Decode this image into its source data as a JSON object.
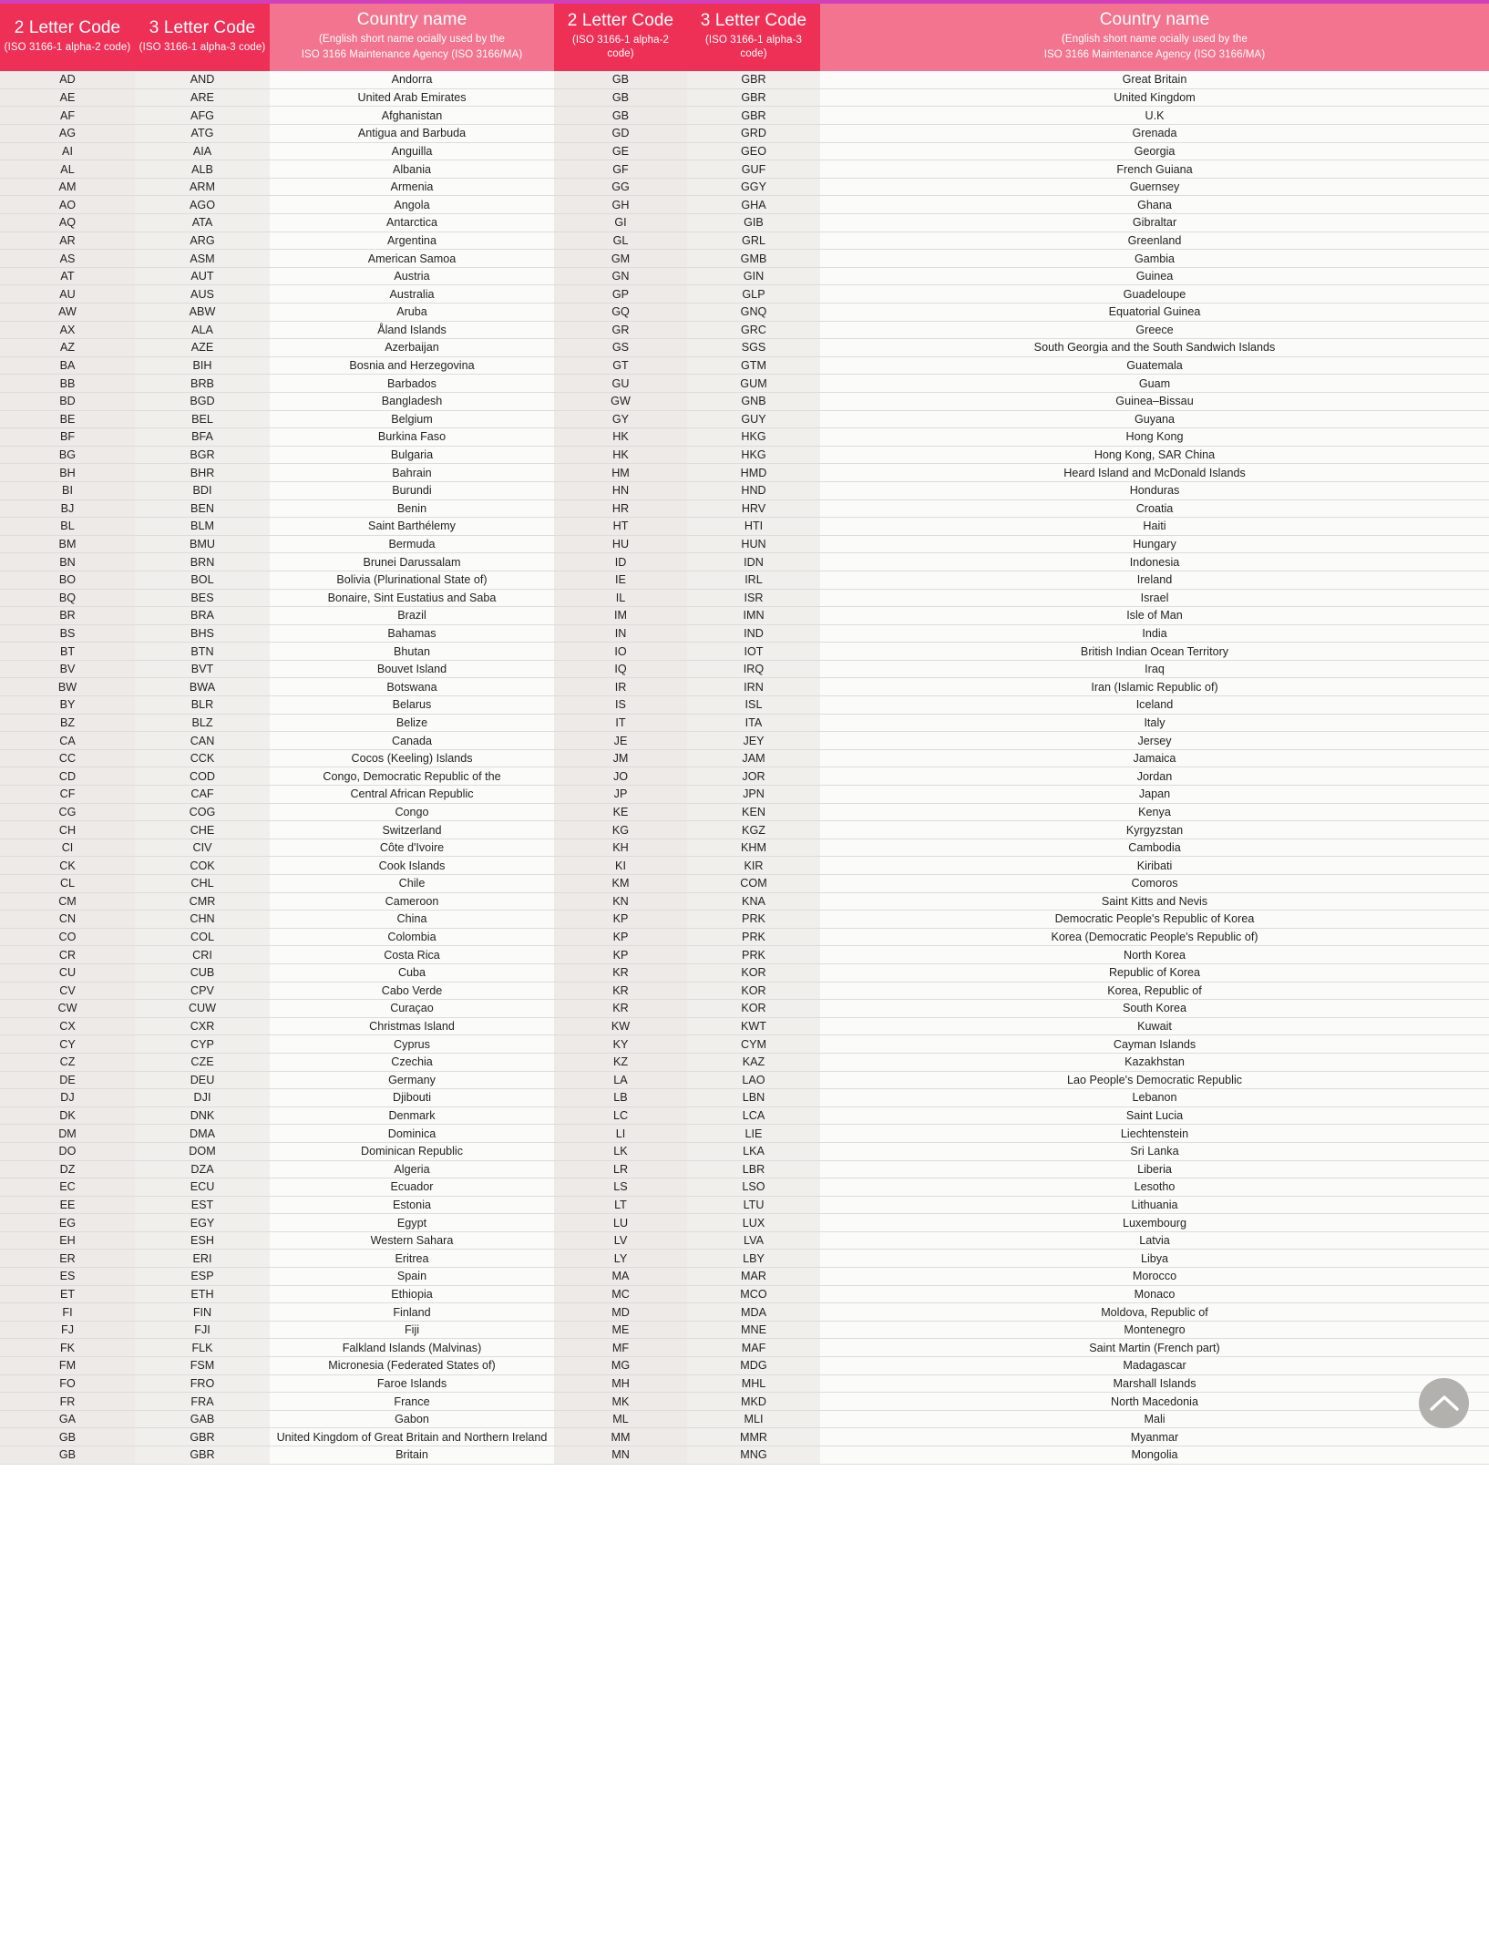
{
  "colors": {
    "accent_code_header": "#ef3056",
    "accent_name_header": "#f2748f",
    "top_rule": "#cf3fbe",
    "row_code2_bg": "#edeae7",
    "row_code3_bg": "#f1efec",
    "row_name_bg": "#fbfbfa",
    "scroll_button_bg": "#b3b1ae"
  },
  "headers": {
    "code2_title": "2 Letter Code",
    "code2_sub": "(ISO 3166‑1 alpha‑2 code)",
    "code3_title": "3 Letter Code",
    "code3_sub": "(ISO 3166‑1 alpha‑3 code)",
    "name_title": "Country name",
    "name_sub_line1": "(English short name ocially used by the",
    "name_sub_line2": "ISO 3166 Maintenance Agency (ISO 3166/MA)"
  },
  "scroll_top": {
    "icon": "chevron-up-icon",
    "label": "Scroll to top"
  },
  "chart_data": {
    "type": "table",
    "title": "ISO 3166-1 country codes",
    "columns": [
      "2 Letter Code",
      "3 Letter Code",
      "Country name"
    ],
    "left_rows": [
      [
        "AD",
        "AND",
        "Andorra"
      ],
      [
        "AE",
        "ARE",
        "United Arab Emirates"
      ],
      [
        "AF",
        "AFG",
        "Afghanistan"
      ],
      [
        "AG",
        "ATG",
        "Antigua and Barbuda"
      ],
      [
        "AI",
        "AIA",
        "Anguilla"
      ],
      [
        "AL",
        "ALB",
        "Albania"
      ],
      [
        "AM",
        "ARM",
        "Armenia"
      ],
      [
        "AO",
        "AGO",
        "Angola"
      ],
      [
        "AQ",
        "ATA",
        "Antarctica"
      ],
      [
        "AR",
        "ARG",
        "Argentina"
      ],
      [
        "AS",
        "ASM",
        "American Samoa"
      ],
      [
        "AT",
        "AUT",
        "Austria"
      ],
      [
        "AU",
        "AUS",
        "Australia"
      ],
      [
        "AW",
        "ABW",
        "Aruba"
      ],
      [
        "AX",
        "ALA",
        "Åland Islands"
      ],
      [
        "AZ",
        "AZE",
        "Azerbaijan"
      ],
      [
        "BA",
        "BIH",
        "Bosnia and Herzegovina"
      ],
      [
        "BB",
        "BRB",
        "Barbados"
      ],
      [
        "BD",
        "BGD",
        "Bangladesh"
      ],
      [
        "BE",
        "BEL",
        "Belgium"
      ],
      [
        "BF",
        "BFA",
        "Burkina Faso"
      ],
      [
        "BG",
        "BGR",
        "Bulgaria"
      ],
      [
        "BH",
        "BHR",
        "Bahrain"
      ],
      [
        "BI",
        "BDI",
        "Burundi"
      ],
      [
        "BJ",
        "BEN",
        "Benin"
      ],
      [
        "BL",
        "BLM",
        "Saint Barthélemy"
      ],
      [
        "BM",
        "BMU",
        "Bermuda"
      ],
      [
        "BN",
        "BRN",
        "Brunei Darussalam"
      ],
      [
        "BO",
        "BOL",
        "Bolivia (Plurinational State of)"
      ],
      [
        "BQ",
        "BES",
        "Bonaire, Sint Eustatius and Saba"
      ],
      [
        "BR",
        "BRA",
        "Brazil"
      ],
      [
        "BS",
        "BHS",
        "Bahamas"
      ],
      [
        "BT",
        "BTN",
        "Bhutan"
      ],
      [
        "BV",
        "BVT",
        "Bouvet Island"
      ],
      [
        "BW",
        "BWA",
        "Botswana"
      ],
      [
        "BY",
        "BLR",
        "Belarus"
      ],
      [
        "BZ",
        "BLZ",
        "Belize"
      ],
      [
        "CA",
        "CAN",
        "Canada"
      ],
      [
        "CC",
        "CCK",
        "Cocos (Keeling) Islands"
      ],
      [
        "CD",
        "COD",
        "Congo, Democratic Republic of the"
      ],
      [
        "CF",
        "CAF",
        "Central African Republic"
      ],
      [
        "CG",
        "COG",
        "Congo"
      ],
      [
        "CH",
        "CHE",
        "Switzerland"
      ],
      [
        "CI",
        "CIV",
        "Côte d'Ivoire"
      ],
      [
        "CK",
        "COK",
        "Cook Islands"
      ],
      [
        "CL",
        "CHL",
        "Chile"
      ],
      [
        "CM",
        "CMR",
        "Cameroon"
      ],
      [
        "CN",
        "CHN",
        "China"
      ],
      [
        "CO",
        "COL",
        "Colombia"
      ],
      [
        "CR",
        "CRI",
        "Costa Rica"
      ],
      [
        "CU",
        "CUB",
        "Cuba"
      ],
      [
        "CV",
        "CPV",
        "Cabo Verde"
      ],
      [
        "CW",
        "CUW",
        "Curaçao"
      ],
      [
        "CX",
        "CXR",
        "Christmas Island"
      ],
      [
        "CY",
        "CYP",
        "Cyprus"
      ],
      [
        "CZ",
        "CZE",
        "Czechia"
      ],
      [
        "DE",
        "DEU",
        "Germany"
      ],
      [
        "DJ",
        "DJI",
        "Djibouti"
      ],
      [
        "DK",
        "DNK",
        "Denmark"
      ],
      [
        "DM",
        "DMA",
        "Dominica"
      ],
      [
        "DO",
        "DOM",
        "Dominican Republic"
      ],
      [
        "DZ",
        "DZA",
        "Algeria"
      ],
      [
        "EC",
        "ECU",
        "Ecuador"
      ],
      [
        "EE",
        "EST",
        "Estonia"
      ],
      [
        "EG",
        "EGY",
        "Egypt"
      ],
      [
        "EH",
        "ESH",
        "Western Sahara"
      ],
      [
        "ER",
        "ERI",
        "Eritrea"
      ],
      [
        "ES",
        "ESP",
        "Spain"
      ],
      [
        "ET",
        "ETH",
        "Ethiopia"
      ],
      [
        "FI",
        "FIN",
        "Finland"
      ],
      [
        "FJ",
        "FJI",
        "Fiji"
      ],
      [
        "FK",
        "FLK",
        "Falkland Islands (Malvinas)"
      ],
      [
        "FM",
        "FSM",
        "Micronesia (Federated States of)"
      ],
      [
        "FO",
        "FRO",
        "Faroe Islands"
      ],
      [
        "FR",
        "FRA",
        "France"
      ],
      [
        "GA",
        "GAB",
        "Gabon"
      ],
      [
        "GB",
        "GBR",
        "United Kingdom of Great Britain and Northern Ireland"
      ],
      [
        "GB",
        "GBR",
        "Britain"
      ]
    ],
    "right_rows": [
      [
        "GB",
        "GBR",
        "Great Britain"
      ],
      [
        "GB",
        "GBR",
        "United Kingdom"
      ],
      [
        "GB",
        "GBR",
        "U.K"
      ],
      [
        "GD",
        "GRD",
        "Grenada"
      ],
      [
        "GE",
        "GEO",
        "Georgia"
      ],
      [
        "GF",
        "GUF",
        "French Guiana"
      ],
      [
        "GG",
        "GGY",
        "Guernsey"
      ],
      [
        "GH",
        "GHA",
        "Ghana"
      ],
      [
        "GI",
        "GIB",
        "Gibraltar"
      ],
      [
        "GL",
        "GRL",
        "Greenland"
      ],
      [
        "GM",
        "GMB",
        "Gambia"
      ],
      [
        "GN",
        "GIN",
        "Guinea"
      ],
      [
        "GP",
        "GLP",
        "Guadeloupe"
      ],
      [
        "GQ",
        "GNQ",
        "Equatorial Guinea"
      ],
      [
        "GR",
        "GRC",
        "Greece"
      ],
      [
        "GS",
        "SGS",
        "South Georgia and the South Sandwich Islands"
      ],
      [
        "GT",
        "GTM",
        "Guatemala"
      ],
      [
        "GU",
        "GUM",
        "Guam"
      ],
      [
        "GW",
        "GNB",
        "Guinea–Bissau"
      ],
      [
        "GY",
        "GUY",
        "Guyana"
      ],
      [
        "HK",
        "HKG",
        "Hong Kong"
      ],
      [
        "HK",
        "HKG",
        "Hong Kong, SAR China"
      ],
      [
        "HM",
        "HMD",
        "Heard Island and McDonald Islands"
      ],
      [
        "HN",
        "HND",
        "Honduras"
      ],
      [
        "HR",
        "HRV",
        "Croatia"
      ],
      [
        "HT",
        "HTI",
        "Haiti"
      ],
      [
        "HU",
        "HUN",
        "Hungary"
      ],
      [
        "ID",
        "IDN",
        "Indonesia"
      ],
      [
        "IE",
        "IRL",
        "Ireland"
      ],
      [
        "IL",
        "ISR",
        "Israel"
      ],
      [
        "IM",
        "IMN",
        "Isle of Man"
      ],
      [
        "IN",
        "IND",
        "India"
      ],
      [
        "IO",
        "IOT",
        "British Indian Ocean Territory"
      ],
      [
        "IQ",
        "IRQ",
        "Iraq"
      ],
      [
        "IR",
        "IRN",
        "Iran (Islamic Republic of)"
      ],
      [
        "IS",
        "ISL",
        "Iceland"
      ],
      [
        "IT",
        "ITA",
        "Italy"
      ],
      [
        "JE",
        "JEY",
        "Jersey"
      ],
      [
        "JM",
        "JAM",
        "Jamaica"
      ],
      [
        "JO",
        "JOR",
        "Jordan"
      ],
      [
        "JP",
        "JPN",
        "Japan"
      ],
      [
        "KE",
        "KEN",
        "Kenya"
      ],
      [
        "KG",
        "KGZ",
        "Kyrgyzstan"
      ],
      [
        "KH",
        "KHM",
        "Cambodia"
      ],
      [
        "KI",
        "KIR",
        "Kiribati"
      ],
      [
        "KM",
        "COM",
        "Comoros"
      ],
      [
        "KN",
        "KNA",
        "Saint Kitts and Nevis"
      ],
      [
        "KP",
        "PRK",
        "Democratic People's Republic of Korea"
      ],
      [
        "KP",
        "PRK",
        "Korea (Democratic People's Republic of)"
      ],
      [
        "KP",
        "PRK",
        "North Korea"
      ],
      [
        "KR",
        "KOR",
        "Republic of Korea"
      ],
      [
        "KR",
        "KOR",
        "Korea, Republic of"
      ],
      [
        "KR",
        "KOR",
        "South Korea"
      ],
      [
        "KW",
        "KWT",
        "Kuwait"
      ],
      [
        "KY",
        "CYM",
        "Cayman Islands"
      ],
      [
        "KZ",
        "KAZ",
        "Kazakhstan"
      ],
      [
        "LA",
        "LAO",
        "Lao People's Democratic Republic"
      ],
      [
        "LB",
        "LBN",
        "Lebanon"
      ],
      [
        "LC",
        "LCA",
        "Saint Lucia"
      ],
      [
        "LI",
        "LIE",
        "Liechtenstein"
      ],
      [
        "LK",
        "LKA",
        "Sri Lanka"
      ],
      [
        "LR",
        "LBR",
        "Liberia"
      ],
      [
        "LS",
        "LSO",
        "Lesotho"
      ],
      [
        "LT",
        "LTU",
        "Lithuania"
      ],
      [
        "LU",
        "LUX",
        "Luxembourg"
      ],
      [
        "LV",
        "LVA",
        "Latvia"
      ],
      [
        "LY",
        "LBY",
        "Libya"
      ],
      [
        "MA",
        "MAR",
        "Morocco"
      ],
      [
        "MC",
        "MCO",
        "Monaco"
      ],
      [
        "MD",
        "MDA",
        "Moldova, Republic of"
      ],
      [
        "ME",
        "MNE",
        "Montenegro"
      ],
      [
        "MF",
        "MAF",
        "Saint Martin (French part)"
      ],
      [
        "MG",
        "MDG",
        "Madagascar"
      ],
      [
        "MH",
        "MHL",
        "Marshall Islands"
      ],
      [
        "MK",
        "MKD",
        "North Macedonia"
      ],
      [
        "ML",
        "MLI",
        "Mali"
      ],
      [
        "MM",
        "MMR",
        "Myanmar"
      ],
      [
        "MN",
        "MNG",
        "Mongolia"
      ]
    ]
  }
}
